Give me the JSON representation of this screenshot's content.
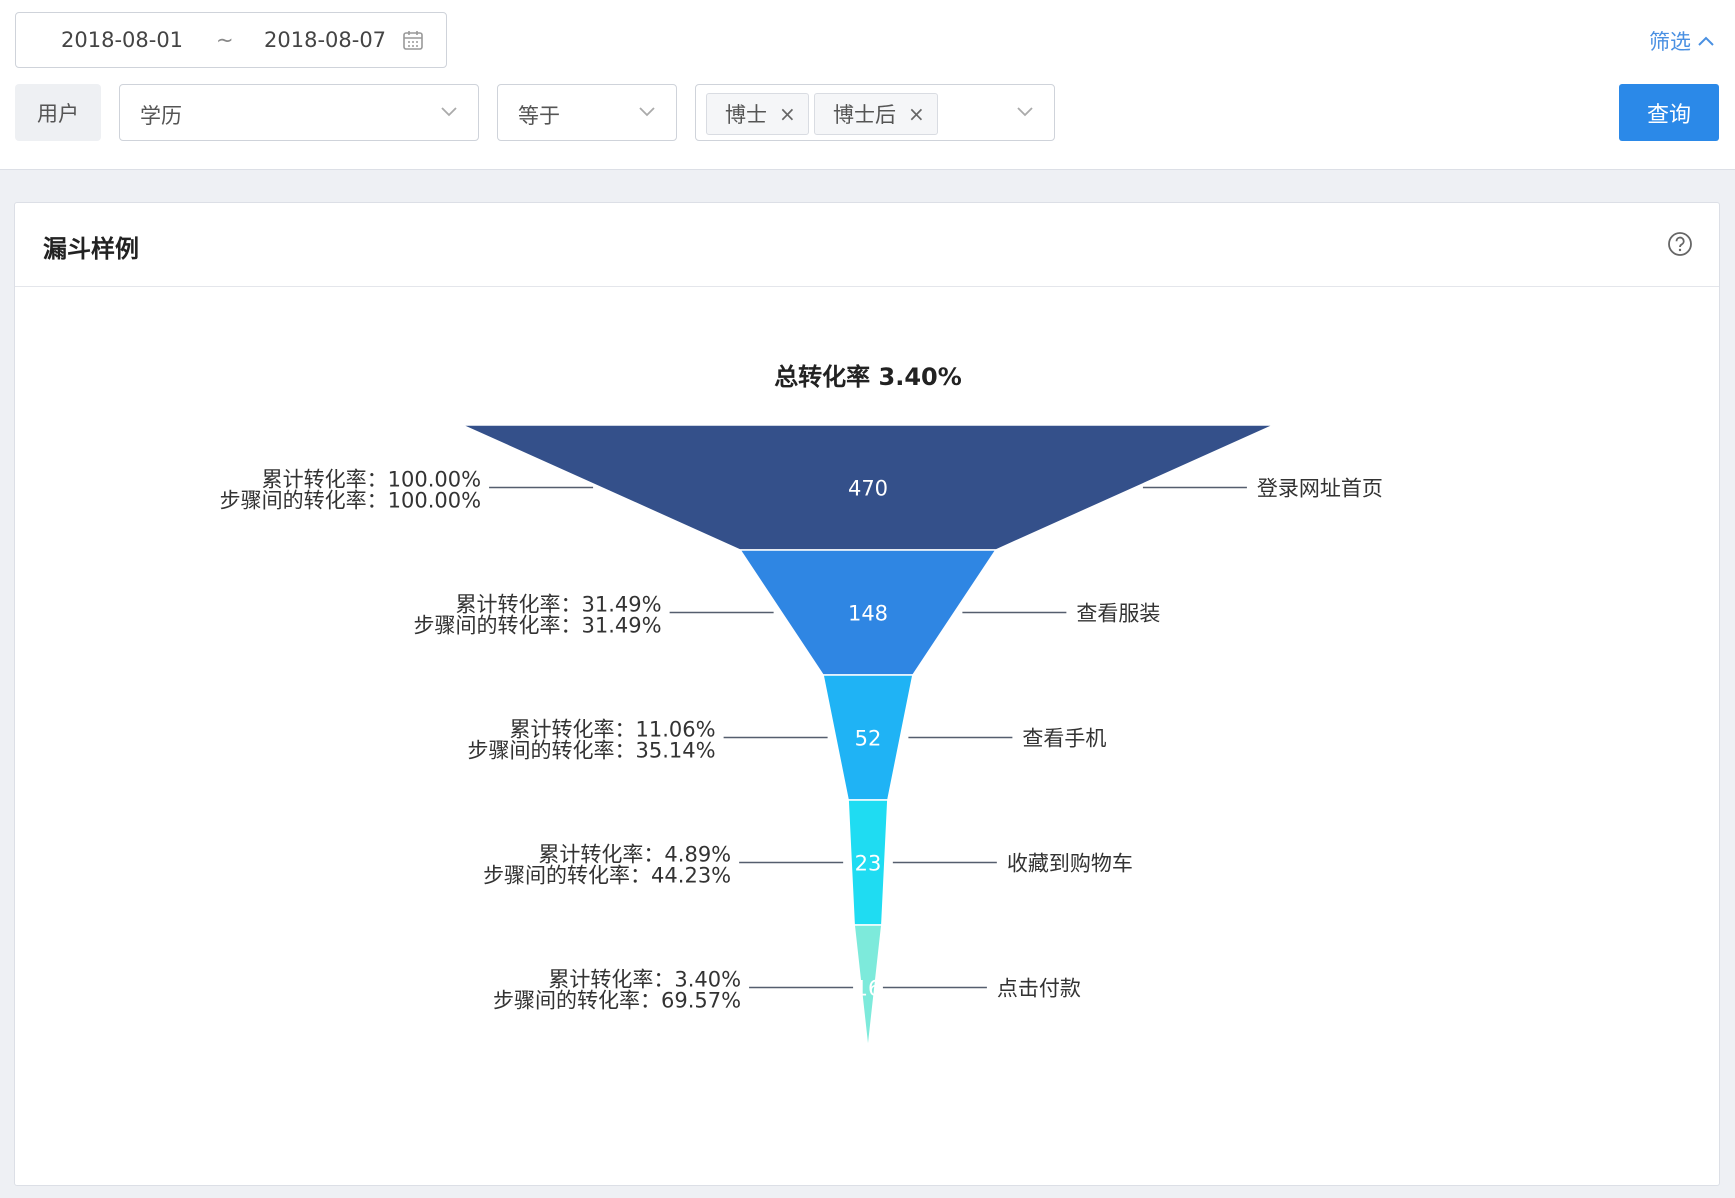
{
  "filters": {
    "date_start": "2018-08-01",
    "date_separator": "~",
    "date_end": "2018-08-07",
    "toggle_label": "筛选",
    "user_label": "用户",
    "field_value": "学历",
    "operator_value": "等于",
    "tags": [
      "博士",
      "博士后"
    ],
    "tag_close": "×",
    "query_label": "查询"
  },
  "card": {
    "title": "漏斗样例"
  },
  "chart_data": {
    "type": "funnel",
    "title": "总转化率 3.40%",
    "steps": [
      {
        "name": "登录网址首页",
        "value": 470,
        "cumulative": "累计转化率：100.00%",
        "step_rate": "步骤间的转化率：100.00%",
        "color": "#34508a"
      },
      {
        "name": "查看服装",
        "value": 148,
        "cumulative": "累计转化率：31.49%",
        "step_rate": "步骤间的转化率：31.49%",
        "color": "#2f86e3"
      },
      {
        "name": "查看手机",
        "value": 52,
        "cumulative": "累计转化率：11.06%",
        "step_rate": "步骤间的转化率：35.14%",
        "color": "#1fb3f5"
      },
      {
        "name": "收藏到购物车",
        "value": 23,
        "cumulative": "累计转化率：4.89%",
        "step_rate": "步骤间的转化率：44.23%",
        "color": "#1fdcf2"
      },
      {
        "name": "点击付款",
        "value": 16,
        "cumulative": "累计转化率：3.40%",
        "step_rate": "步骤间的转化率：69.57%",
        "color": "#7deadb"
      }
    ]
  }
}
